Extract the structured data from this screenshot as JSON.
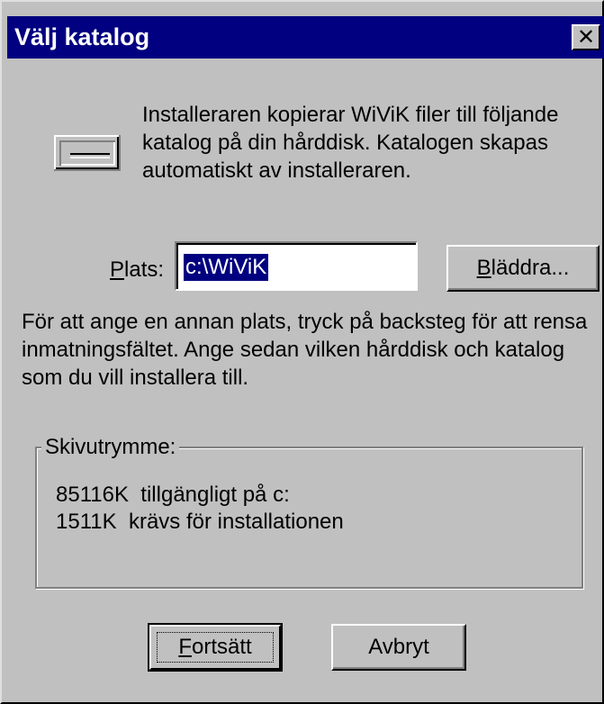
{
  "window": {
    "title": "Välj katalog",
    "close_glyph": "✕"
  },
  "intro": {
    "icon": "hard-drive-icon",
    "text": "Installeraren kopierar WiViK filer till följande katalog på din hårddisk. Katalogen skapas automatiskt av installeraren."
  },
  "location": {
    "label_mnemonic": "P",
    "label_rest": "lats:",
    "value": "c:\\WiViK",
    "browse_mnemonic": "B",
    "browse_rest": "läddra..."
  },
  "instructions": "För att ange en annan plats, tryck på backsteg för att rensa inmatningsfältet. Ange sedan vilken hårddisk och katalog som du vill installera till.",
  "disk_space": {
    "title": "Skivutrymme:",
    "available": "85116K  tillgängligt på c:",
    "required": "1511K  krävs för installationen"
  },
  "buttons": {
    "continue_mnemonic": "F",
    "continue_rest": "ortsätt",
    "cancel": "Avbryt"
  },
  "colors": {
    "titlebar": "#000080",
    "face": "#c0c0c0",
    "selection": "#000080"
  }
}
